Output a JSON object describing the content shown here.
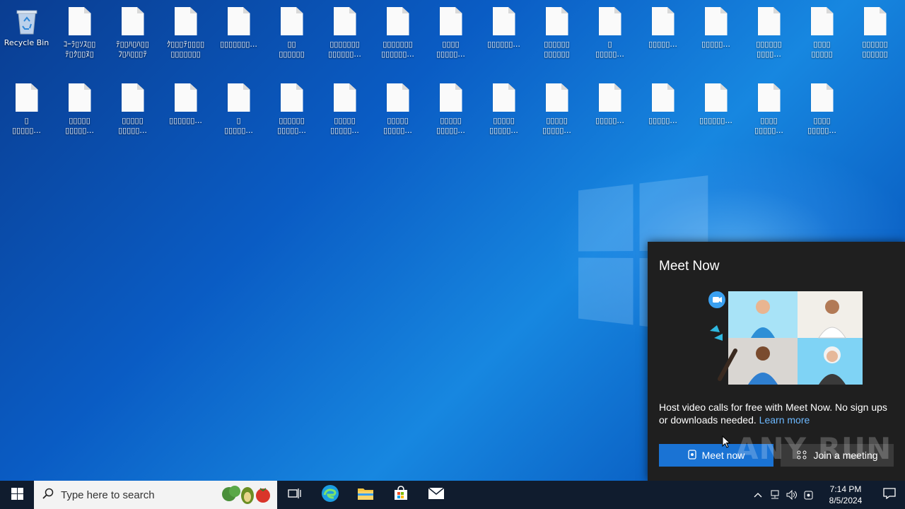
{
  "desktop": {
    "recycle_bin_label": "Recycle Bin",
    "files": [
      "ｺｰﾗ▯ｿｽ▯▯\nﾃ▯ｸ▯▯ﾇ▯",
      "ﾃ▯▯ﾊ▯ﾊ▯▯\nﾌ▯ﾊ▯▯▯ﾃ",
      "ｸ▯▯▯ﾃ▯▯▯▯\n▯▯▯▯▯▯▯",
      "▯▯▯▯▯▯▯...",
      "▯▯\n▯▯▯▯▯▯",
      "▯▯▯▯▯▯▯\n▯▯▯▯▯▯...",
      "▯▯▯▯▯▯▯\n▯▯▯▯▯▯...",
      "▯▯▯▯\n▯▯▯▯▯...",
      "▯▯▯▯▯▯...",
      "▯▯▯▯▯▯\n▯▯▯▯▯▯",
      "▯\n▯▯▯▯▯...",
      "▯▯▯▯▯...",
      "▯▯▯▯▯...",
      "▯▯▯▯▯▯\n▯▯▯▯...",
      "▯▯▯▯\n▯▯▯▯▯",
      "▯▯▯▯▯▯\n▯▯▯▯▯▯",
      "▯\n▯▯▯▯▯...",
      "▯▯▯▯▯\n▯▯▯▯▯...",
      "▯▯▯▯▯\n▯▯▯▯▯...",
      "▯▯▯▯▯▯...",
      "▯\n▯▯▯▯▯...",
      "▯▯▯▯▯▯\n▯▯▯▯▯...",
      "▯▯▯▯▯\n▯▯▯▯▯...",
      "▯▯▯▯▯\n▯▯▯▯▯...",
      "▯▯▯▯▯\n▯▯▯▯▯...",
      "▯▯▯▯▯\n▯▯▯▯▯...",
      "▯▯▯▯▯\n▯▯▯▯▯...",
      "▯▯▯▯▯...",
      "▯▯▯▯▯...",
      "▯▯▯▯▯▯...",
      "▯▯▯▯\n▯▯▯▯▯...",
      "▯▯▯▯\n▯▯▯▯▯..."
    ]
  },
  "flyout": {
    "title": "Meet Now",
    "description": "Host video calls for free with Meet Now. No sign ups or downloads needed.",
    "learn_more": "Learn more",
    "meet_now_button": "Meet now",
    "join_meeting_button": "Join a meeting"
  },
  "watermark": "ANY RUN",
  "taskbar": {
    "search_placeholder": "Type here to search",
    "time": "7:14 PM",
    "date": "8/5/2024"
  },
  "colors": {
    "taskbar_bg": "#101c2e",
    "flyout_bg": "#1f1f1f",
    "accent": "#1a73d4",
    "link": "#6cb8ff"
  }
}
